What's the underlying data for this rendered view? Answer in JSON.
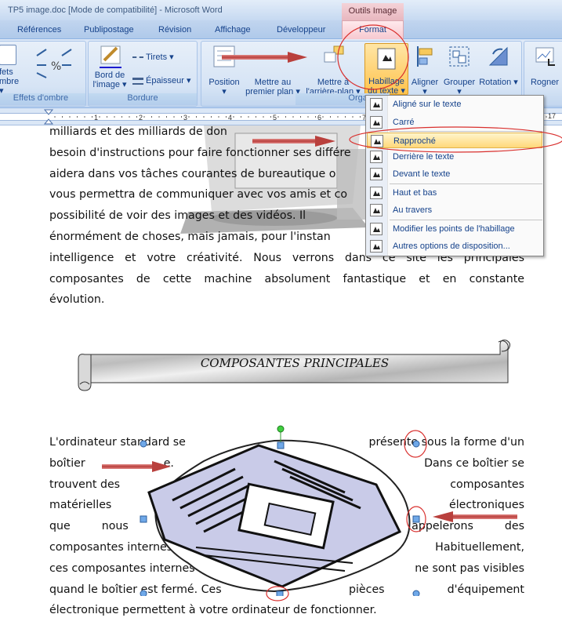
{
  "titlebar": {
    "title": "TP5 image.doc [Mode de compatibilité] - Microsoft Word",
    "context_group": "Outils Image"
  },
  "tabs": [
    "Références",
    "Publipostage",
    "Révision",
    "Affichage",
    "Développeur",
    "Format"
  ],
  "ribbon": {
    "effets": {
      "label_line1": "fets",
      "label_line2": "mbre ▾",
      "group": "Effets d'ombre"
    },
    "bordure": {
      "tirets": "Tirets ▾",
      "epaisseur": "Épaisseur ▾",
      "bord_line1": "Bord de",
      "bord_line2": "l'image ▾",
      "group": "Bordure"
    },
    "organiser": {
      "position": "Position",
      "premier_line1": "Mettre au",
      "premier_line2": "premier plan ▾",
      "arriere_line1": "Mettre à",
      "arriere_line2": "l'arrière-plan ▾",
      "habillage_line1": "Habillage",
      "habillage_line2": "du texte ▾",
      "aligner": "Aligner ▾",
      "grouper": "Grouper ▾",
      "rotation": "Rotation ▾",
      "group": "Organ"
    },
    "rogner": "Rogner"
  },
  "ruler": {
    "marks": [
      "1",
      "2",
      "3",
      "4",
      "5",
      "6",
      "7",
      "8",
      "9",
      "10",
      "17"
    ]
  },
  "menu": {
    "items": [
      "Aligné sur le texte",
      "Carré",
      "Rapproché",
      "Derrière le texte",
      "Devant le texte",
      "Haut et bas",
      "Au travers",
      "Modifier les points de l'habillage",
      "Autres options de disposition..."
    ],
    "active_index": 2
  },
  "doc": {
    "para1_lines": [
      "milliards et des milliards de don",
      "besoin d'instructions pour faire fonctionner ses différe",
      "aidera dans vos tâches courantes de bureautique o",
      "vous permettra de communiquer avec vos amis et co",
      "possibilité de voir des images et des vidéos. Il",
      "énormément de choses, mais jamais, pour l'instan",
      "intelligence et votre créativité. Nous verrons dans ce site les principales",
      "composantes de cette machine absolument fantastique et en constante",
      "évolution."
    ],
    "banner": "COMPOSANTES PRINCIPALES",
    "para2_rows": [
      [
        "L'ordinateur standard se",
        "présente sous la forme d'un"
      ],
      [
        "boîtier",
        "e.",
        "Dans ce boîtier se"
      ],
      [
        "trouvent des",
        "composantes"
      ],
      [
        "matérielles",
        "électroniques"
      ],
      [
        "que",
        "nous",
        "appelerons",
        "des"
      ],
      [
        "composantes internes.",
        "Habituellement,"
      ],
      [
        "ces composantes internes",
        "ne sont pas visibles"
      ],
      [
        "quand le boîtier est fermé. Ces",
        "pièces",
        "d'équipement"
      ],
      [
        "électronique permettent à votre ordinateur de fonctionner."
      ]
    ]
  },
  "colors": {
    "annotation_red": "#d9302e",
    "arrow_red": "#c0504d",
    "highlight": "#ffd87a"
  }
}
